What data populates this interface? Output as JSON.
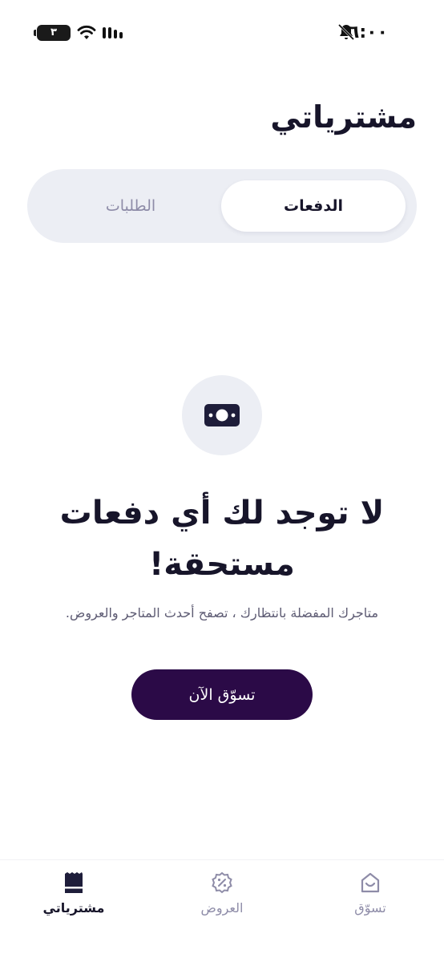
{
  "status_bar": {
    "time": "٦:٠٠",
    "battery": "٣",
    "icons": [
      "bell-off-icon",
      "wifi-icon",
      "signal-icon",
      "battery-icon"
    ]
  },
  "header": {
    "title": "مشترياتي"
  },
  "tabs": [
    {
      "label": "الدفعات",
      "selected": true
    },
    {
      "label": "الطلبات",
      "selected": false
    }
  ],
  "empty_state": {
    "icon": "money-bill-icon",
    "title": "لا توجد لك أي دفعات مستحقة!",
    "description": "متاجرك المفضلة بانتظارك ، تصفح أحدث المتاجر والعروض.",
    "button_label": "تسوّق الآن"
  },
  "bottom_nav": {
    "items": [
      {
        "label": "مشترياتي",
        "icon": "receipt-icon",
        "active": true
      },
      {
        "label": "العروض",
        "icon": "discount-badge-icon",
        "active": false
      },
      {
        "label": "تسوّق",
        "icon": "shop-home-icon",
        "active": false
      }
    ]
  },
  "colors": {
    "primary": "#2b0a47",
    "text": "#17152a",
    "muted": "#8e8ca8",
    "surface": "#eceef4"
  }
}
